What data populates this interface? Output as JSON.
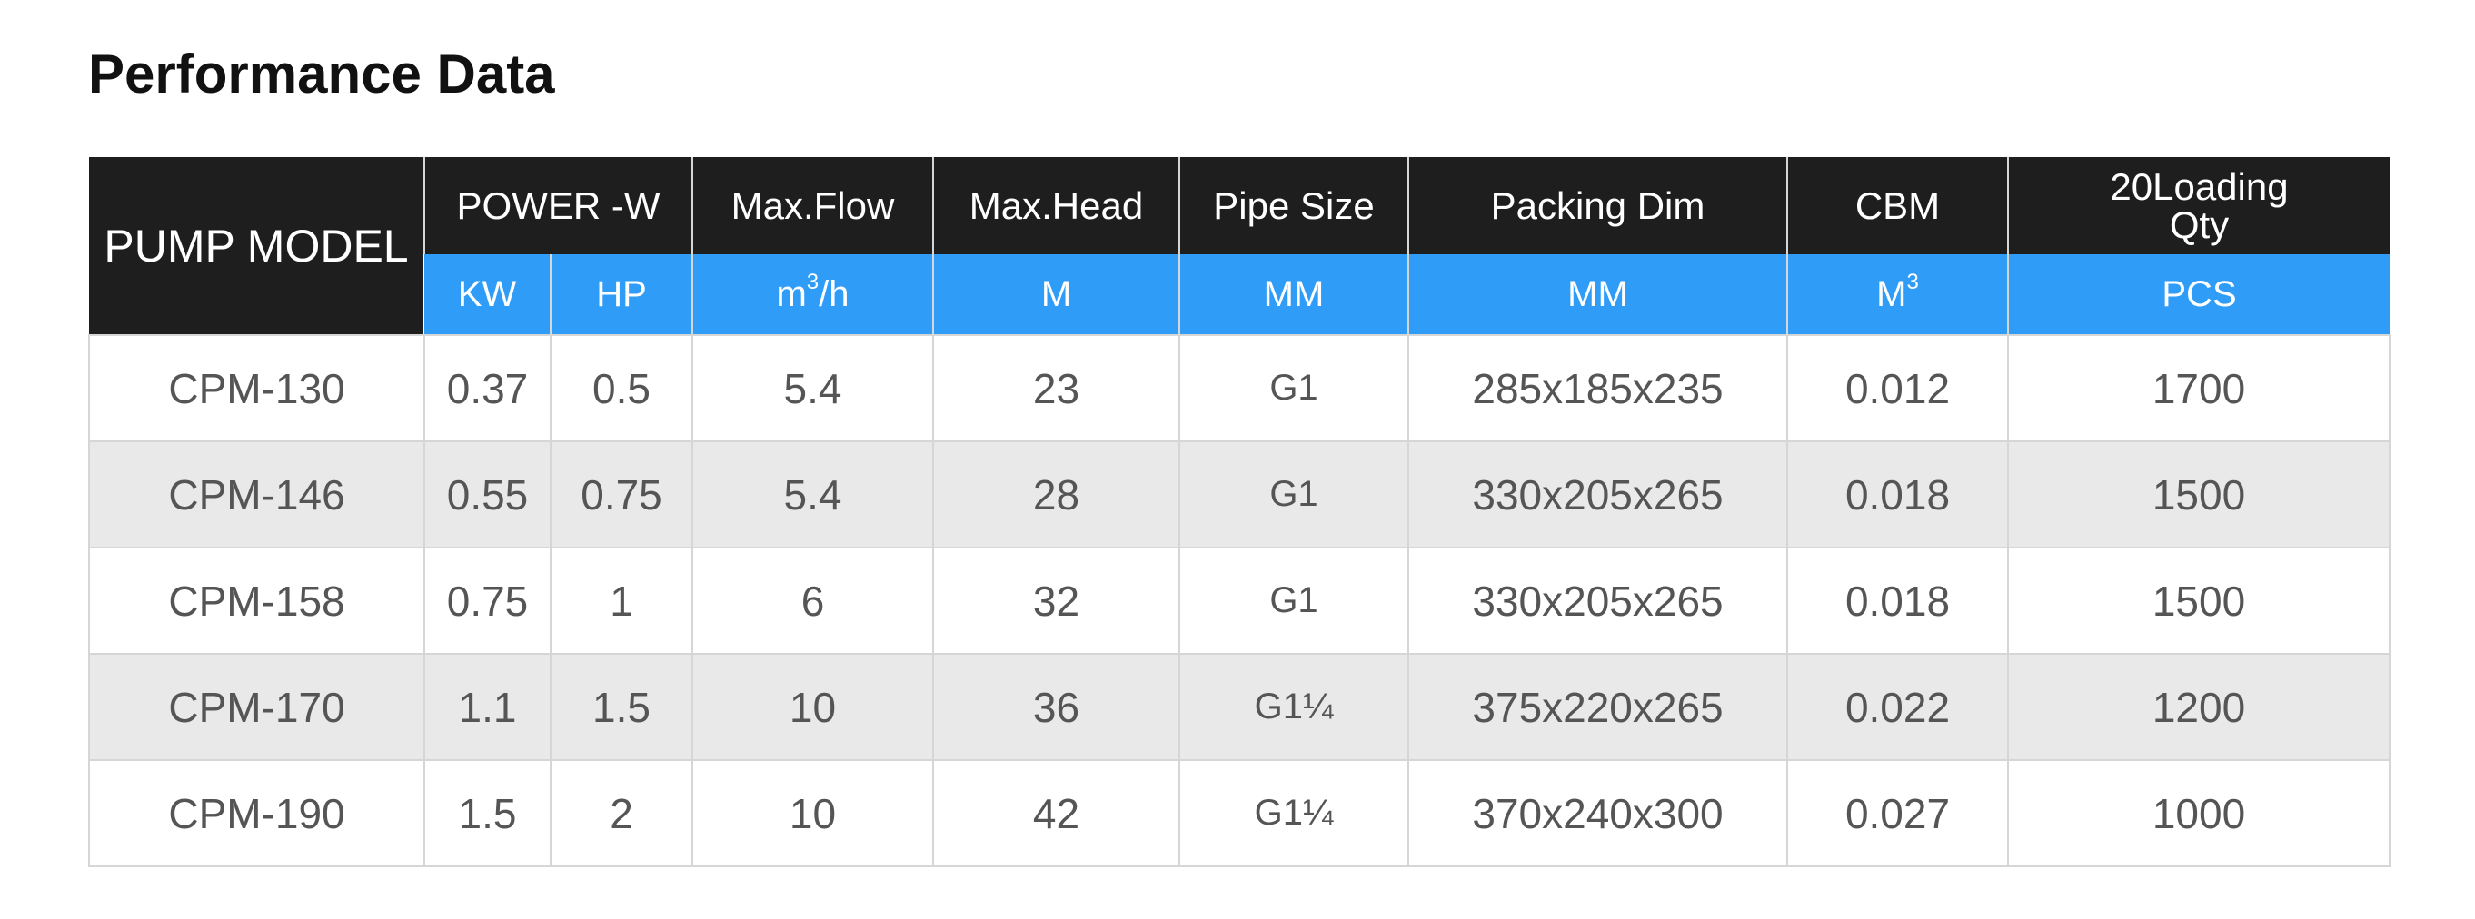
{
  "page_title": "Performance Data",
  "table": {
    "headers": {
      "pump_model": "PUMP MODEL",
      "power": "POWER -W",
      "max_flow": "Max.Flow",
      "max_head": "Max.Head",
      "pipe_size": "Pipe Size",
      "packing_dim": "Packing Dim",
      "cbm": "CBM",
      "loading_qty_line1": "20Loading",
      "loading_qty_line2": "Qty"
    },
    "units": {
      "kw": "KW",
      "hp": "HP",
      "flow_base": "m",
      "flow_sup": "3",
      "flow_tail": "/h",
      "head": "M",
      "pipe": "MM",
      "packing": "MM",
      "cbm_base": "M",
      "cbm_sup": "3",
      "qty": "PCS"
    },
    "rows": [
      {
        "model": "CPM-130",
        "kw": "0.37",
        "hp": "0.5",
        "flow": "5.4",
        "head": "23",
        "pipe": "G1",
        "packing": "285x185x235",
        "cbm": "0.012",
        "qty": "1700"
      },
      {
        "model": "CPM-146",
        "kw": "0.55",
        "hp": "0.75",
        "flow": "5.4",
        "head": "28",
        "pipe": "G1",
        "packing": "330x205x265",
        "cbm": "0.018",
        "qty": "1500"
      },
      {
        "model": "CPM-158",
        "kw": "0.75",
        "hp": "1",
        "flow": "6",
        "head": "32",
        "pipe": "G1",
        "packing": "330x205x265",
        "cbm": "0.018",
        "qty": "1500"
      },
      {
        "model": "CPM-170",
        "kw": "1.1",
        "hp": "1.5",
        "flow": "10",
        "head": "36",
        "pipe": "G1¼",
        "packing": "375x220x265",
        "cbm": "0.022",
        "qty": "1200"
      },
      {
        "model": "CPM-190",
        "kw": "1.5",
        "hp": "2",
        "flow": "10",
        "head": "42",
        "pipe": "G1¼",
        "packing": "370x240x300",
        "cbm": "0.027",
        "qty": "1000"
      }
    ]
  },
  "colors": {
    "header_bg": "#1e1e1e",
    "unit_bg": "#2f9cf8",
    "row_alt_bg": "#e9e9e9",
    "text": "#555555"
  }
}
